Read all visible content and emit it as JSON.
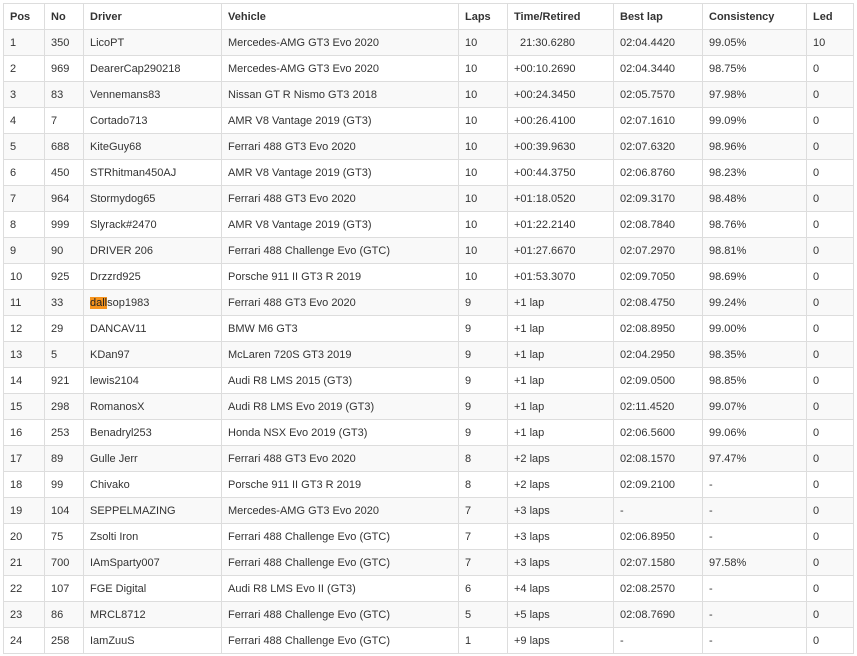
{
  "headers": {
    "pos": "Pos",
    "no": "No",
    "driver": "Driver",
    "vehicle": "Vehicle",
    "laps": "Laps",
    "time": "Time/Retired",
    "best": "Best lap",
    "consistency": "Consistency",
    "led": "Led"
  },
  "rows": [
    {
      "pos": "1",
      "no": "350",
      "driver": "LicoPT",
      "vehicle": "Mercedes-AMG GT3 Evo 2020",
      "laps": "10",
      "time": "21:30.6280",
      "best": "02:04.4420",
      "consistency": "99.05%",
      "led": "10"
    },
    {
      "pos": "2",
      "no": "969",
      "driver": "DearerCap290218",
      "vehicle": "Mercedes-AMG GT3 Evo 2020",
      "laps": "10",
      "time": "+00:10.2690",
      "best": "02:04.3440",
      "consistency": "98.75%",
      "led": "0"
    },
    {
      "pos": "3",
      "no": "83",
      "driver": "Vennemans83",
      "vehicle": "Nissan GT R Nismo GT3 2018",
      "laps": "10",
      "time": "+00:24.3450",
      "best": "02:05.7570",
      "consistency": "97.98%",
      "led": "0"
    },
    {
      "pos": "4",
      "no": "7",
      "driver": "Cortado713",
      "vehicle": "AMR V8 Vantage 2019 (GT3)",
      "laps": "10",
      "time": "+00:26.4100",
      "best": "02:07.1610",
      "consistency": "99.09%",
      "led": "0"
    },
    {
      "pos": "5",
      "no": "688",
      "driver": "KiteGuy68",
      "vehicle": "Ferrari 488 GT3 Evo 2020",
      "laps": "10",
      "time": "+00:39.9630",
      "best": "02:07.6320",
      "consistency": "98.96%",
      "led": "0"
    },
    {
      "pos": "6",
      "no": "450",
      "driver": "STRhitman450AJ",
      "vehicle": "AMR V8 Vantage 2019 (GT3)",
      "laps": "10",
      "time": "+00:44.3750",
      "best": "02:06.8760",
      "consistency": "98.23%",
      "led": "0"
    },
    {
      "pos": "7",
      "no": "964",
      "driver": "Stormydog65",
      "vehicle": "Ferrari 488 GT3 Evo 2020",
      "laps": "10",
      "time": "+01:18.0520",
      "best": "02:09.3170",
      "consistency": "98.48%",
      "led": "0"
    },
    {
      "pos": "8",
      "no": "999",
      "driver": "Slyrack#2470",
      "vehicle": "AMR V8 Vantage 2019 (GT3)",
      "laps": "10",
      "time": "+01:22.2140",
      "best": "02:08.7840",
      "consistency": "98.76%",
      "led": "0"
    },
    {
      "pos": "9",
      "no": "90",
      "driver": "DRIVER 206",
      "vehicle": "Ferrari 488 Challenge Evo (GTC)",
      "laps": "10",
      "time": "+01:27.6670",
      "best": "02:07.2970",
      "consistency": "98.81%",
      "led": "0"
    },
    {
      "pos": "10",
      "no": "925",
      "driver": "Drzzrd925",
      "vehicle": "Porsche 911 II GT3 R 2019",
      "laps": "10",
      "time": "+01:53.3070",
      "best": "02:09.7050",
      "consistency": "98.69%",
      "led": "0"
    },
    {
      "pos": "11",
      "no": "33",
      "driver": "dallsop1983",
      "driver_hl": "dall",
      "driver_rest": "sop1983",
      "vehicle": "Ferrari 488 GT3 Evo 2020",
      "laps": "9",
      "time": "+1 lap",
      "best": "02:08.4750",
      "consistency": "99.24%",
      "led": "0"
    },
    {
      "pos": "12",
      "no": "29",
      "driver": "DANCAV11",
      "vehicle": "BMW M6 GT3",
      "laps": "9",
      "time": "+1 lap",
      "best": "02:08.8950",
      "consistency": "99.00%",
      "led": "0"
    },
    {
      "pos": "13",
      "no": "5",
      "driver": "KDan97",
      "vehicle": "McLaren 720S GT3 2019",
      "laps": "9",
      "time": "+1 lap",
      "best": "02:04.2950",
      "consistency": "98.35%",
      "led": "0"
    },
    {
      "pos": "14",
      "no": "921",
      "driver": "lewis2104",
      "vehicle": "Audi R8 LMS 2015 (GT3)",
      "laps": "9",
      "time": "+1 lap",
      "best": "02:09.0500",
      "consistency": "98.85%",
      "led": "0"
    },
    {
      "pos": "15",
      "no": "298",
      "driver": "RomanosX",
      "vehicle": "Audi R8 LMS Evo 2019 (GT3)",
      "laps": "9",
      "time": "+1 lap",
      "best": "02:11.4520",
      "consistency": "99.07%",
      "led": "0"
    },
    {
      "pos": "16",
      "no": "253",
      "driver": "Benadryl253",
      "vehicle": "Honda NSX Evo 2019 (GT3)",
      "laps": "9",
      "time": "+1 lap",
      "best": "02:06.5600",
      "consistency": "99.06%",
      "led": "0"
    },
    {
      "pos": "17",
      "no": "89",
      "driver": "Gulle Jerr",
      "vehicle": "Ferrari 488 GT3 Evo 2020",
      "laps": "8",
      "time": "+2 laps",
      "best": "02:08.1570",
      "consistency": "97.47%",
      "led": "0"
    },
    {
      "pos": "18",
      "no": "99",
      "driver": "Chivako",
      "vehicle": "Porsche 911 II GT3 R 2019",
      "laps": "8",
      "time": "+2 laps",
      "best": "02:09.2100",
      "consistency": "-",
      "led": "0"
    },
    {
      "pos": "19",
      "no": "104",
      "driver": "SEPPELMAZING",
      "vehicle": "Mercedes-AMG GT3 Evo 2020",
      "laps": "7",
      "time": "+3 laps",
      "best": "-",
      "consistency": "-",
      "led": "0"
    },
    {
      "pos": "20",
      "no": "75",
      "driver": "Zsolti Iron",
      "vehicle": "Ferrari 488 Challenge Evo (GTC)",
      "laps": "7",
      "time": "+3 laps",
      "best": "02:06.8950",
      "consistency": "-",
      "led": "0"
    },
    {
      "pos": "21",
      "no": "700",
      "driver": "IAmSparty007",
      "vehicle": "Ferrari 488 Challenge Evo (GTC)",
      "laps": "7",
      "time": "+3 laps",
      "best": "02:07.1580",
      "consistency": "97.58%",
      "led": "0"
    },
    {
      "pos": "22",
      "no": "107",
      "driver": "FGE Digital",
      "vehicle": "Audi R8 LMS Evo II (GT3)",
      "laps": "6",
      "time": "+4 laps",
      "best": "02:08.2570",
      "consistency": "-",
      "led": "0"
    },
    {
      "pos": "23",
      "no": "86",
      "driver": "MRCL8712",
      "vehicle": "Ferrari 488 Challenge Evo (GTC)",
      "laps": "5",
      "time": "+5 laps",
      "best": "02:08.7690",
      "consistency": "-",
      "led": "0"
    },
    {
      "pos": "24",
      "no": "258",
      "driver": "IamZuuS",
      "vehicle": "Ferrari 488 Challenge Evo (GTC)",
      "laps": "1",
      "time": "+9 laps",
      "best": "-",
      "consistency": "-",
      "led": "0"
    }
  ]
}
